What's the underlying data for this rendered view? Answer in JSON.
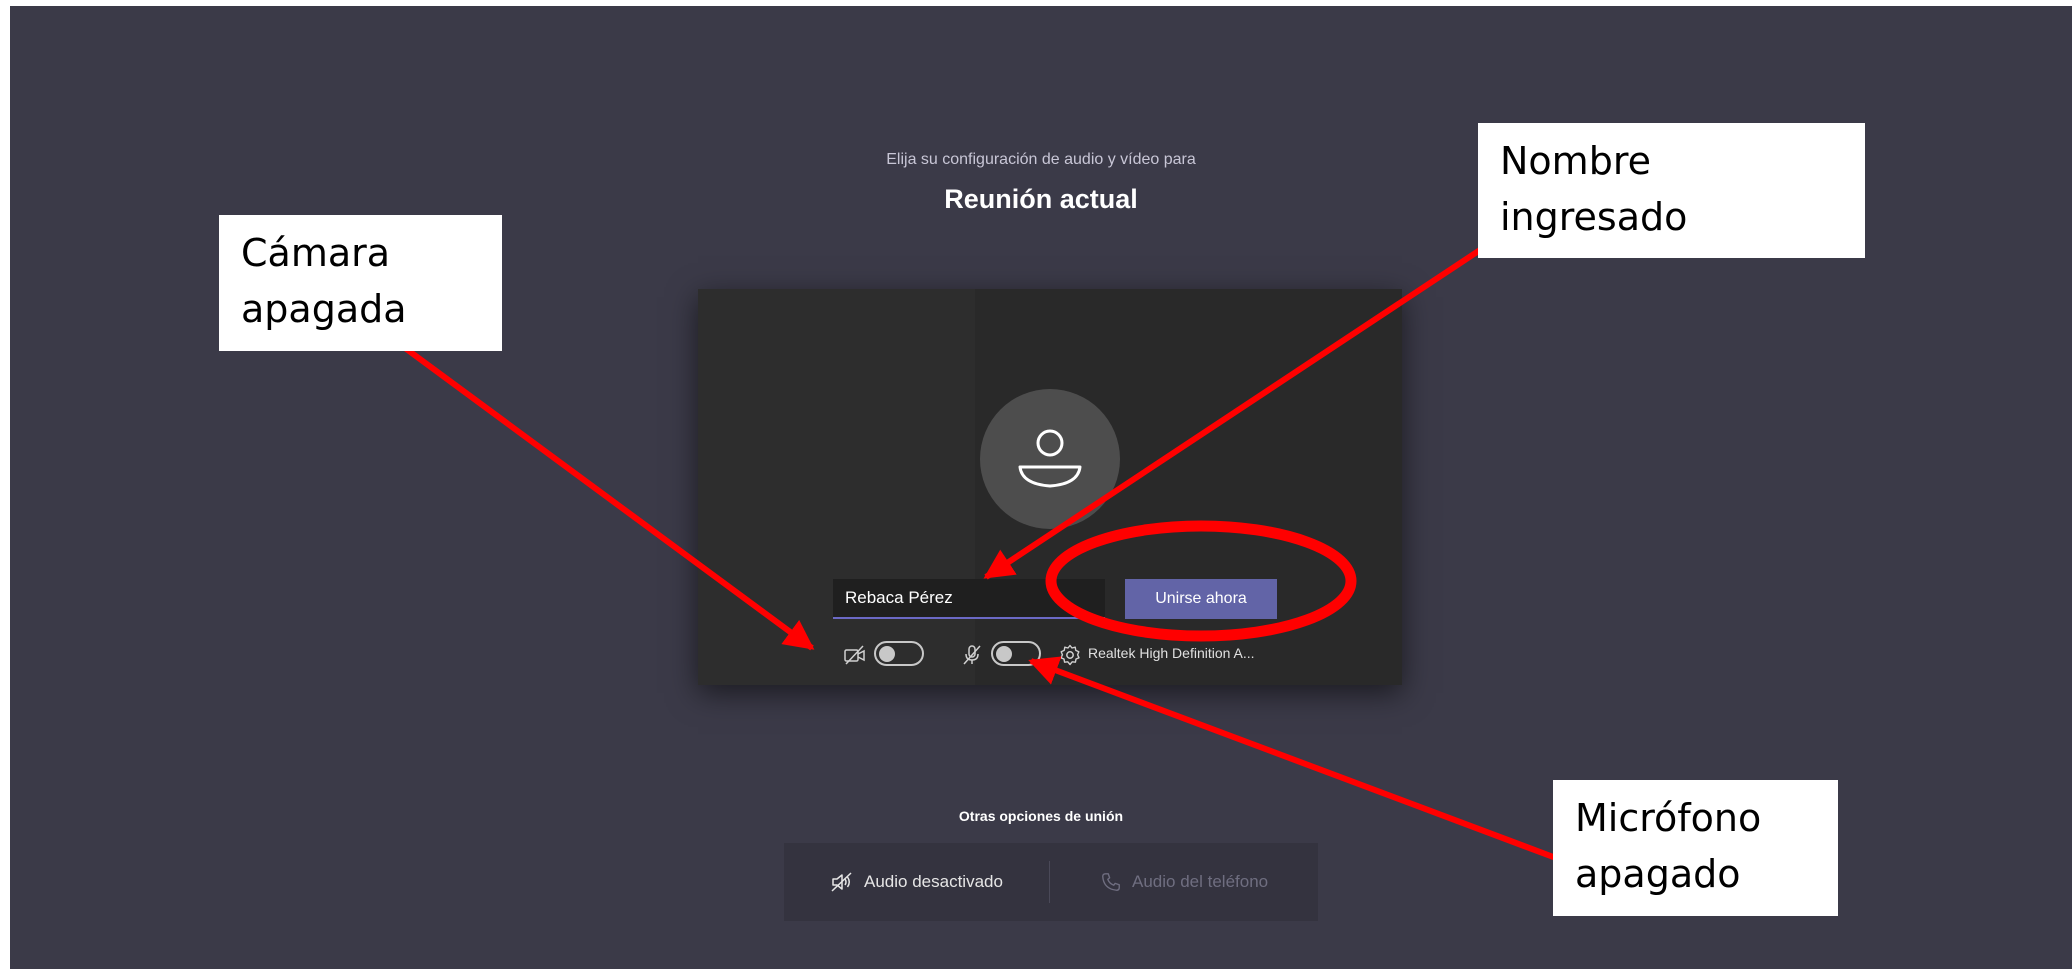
{
  "prejoin": {
    "subtitle": "Elija su configuración de audio y vídeo para",
    "meeting_title": "Reunión actual",
    "name_value": "Rebaca Pérez",
    "join_label": "Unirse ahora",
    "camera_toggle_on": false,
    "mic_toggle_on": false,
    "audio_device": "Realtek High Definition A..."
  },
  "other_options": {
    "title": "Otras opciones de unión",
    "audio_off_label": "Audio desactivado",
    "phone_audio_label": "Audio del teléfono"
  },
  "annotations": {
    "camera": "Cámara apagada",
    "name": "Nombre ingresado",
    "mic": "Micrófono apagado",
    "color": "#ff0000"
  },
  "colors": {
    "background": "#3b3a48",
    "accent": "#6264a7"
  }
}
